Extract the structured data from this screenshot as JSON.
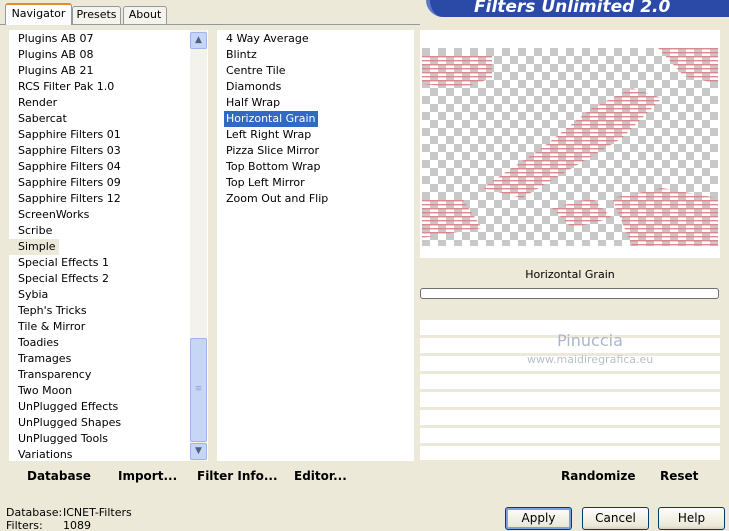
{
  "tabs": [
    "Navigator",
    "Presets",
    "About"
  ],
  "banner_title": "Filters Unlimited 2.0",
  "categories": [
    "Plugins AB 07",
    "Plugins AB 08",
    "Plugins AB 21",
    "RCS Filter Pak 1.0",
    "Render",
    "Sabercat",
    "Sapphire Filters 01",
    "Sapphire Filters 03",
    "Sapphire Filters 04",
    "Sapphire Filters 09",
    "Sapphire Filters 12",
    "ScreenWorks",
    "Scribe",
    "Simple",
    "Special Effects 1",
    "Special Effects 2",
    "Sybia",
    "Teph's Tricks",
    "Tile & Mirror",
    "Toadies",
    "Tramages",
    "Transparency",
    "Two Moon",
    "UnPlugged Effects",
    "UnPlugged Shapes",
    "UnPlugged Tools",
    "Variations"
  ],
  "selected_category": "Simple",
  "filters": [
    "4 Way Average",
    "Blintz",
    "Centre Tile",
    "Diamonds",
    "Half Wrap",
    "Horizontal Grain",
    "Left Right Wrap",
    "Pizza Slice Mirror",
    "Top Bottom Wrap",
    "Top Left Mirror",
    "Zoom Out and Flip"
  ],
  "selected_filter": "Horizontal Grain",
  "preview_filter_name": "Horizontal Grain",
  "watermark": {
    "name": "Pinuccia",
    "site": "www.maidiregrafica.eu"
  },
  "left_buttons": {
    "database": "Database",
    "import": "Import...",
    "filter_info": "Filter Info...",
    "editor": "Editor..."
  },
  "right_buttons": {
    "randomize": "Randomize",
    "reset": "Reset"
  },
  "status": {
    "database_label": "Database:",
    "database_value": "ICNET-Filters",
    "filters_label": "Filters:",
    "filters_value": "1089"
  },
  "dialog_buttons": {
    "apply": "Apply",
    "cancel": "Cancel",
    "help": "Help"
  },
  "colors": {
    "selection": "#316ac5",
    "banner": "#2b4aa8",
    "dialog_bg": "#ece9d8"
  }
}
